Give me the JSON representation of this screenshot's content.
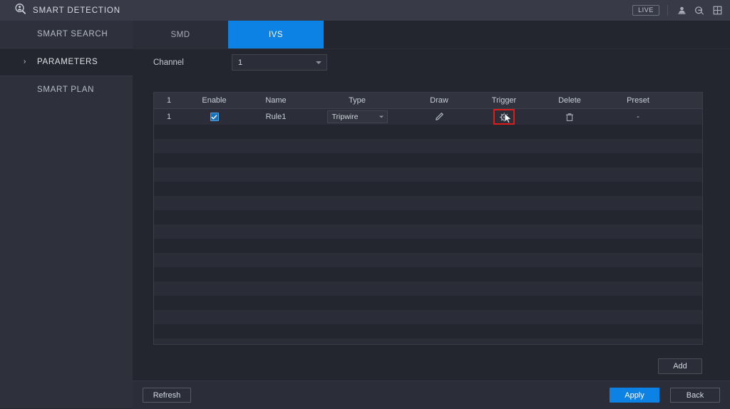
{
  "titlebar": {
    "app_title": "SMART DETECTION",
    "app_icon": "smart-detection-icon",
    "live_label": "LIVE",
    "icons": [
      "user-icon",
      "logout-icon",
      "grid-icon"
    ]
  },
  "sidebar": {
    "items": [
      {
        "label": "SMART SEARCH",
        "active": false
      },
      {
        "label": "PARAMETERS",
        "active": true,
        "chevron": "›"
      },
      {
        "label": "SMART PLAN",
        "active": false
      }
    ]
  },
  "tabs": [
    {
      "label": "SMD",
      "active": false
    },
    {
      "label": "IVS",
      "active": true
    }
  ],
  "channel": {
    "label": "Channel",
    "value": "1",
    "caret_icon": "chevron-down-icon"
  },
  "table": {
    "headers": {
      "index": "1",
      "enable": "Enable",
      "name": "Name",
      "type": "Type",
      "draw": "Draw",
      "trigger": "Trigger",
      "delete": "Delete",
      "preset": "Preset"
    },
    "rows": [
      {
        "index": "1",
        "enabled": true,
        "name": "Rule1",
        "type": "Tripwire",
        "draw_icon": "pencil-icon",
        "trigger_icon": "gear-icon",
        "delete_icon": "trash-icon",
        "preset": "-",
        "trigger_highlighted": true
      }
    ],
    "empty_row_count": 15
  },
  "buttons": {
    "add": "Add",
    "refresh": "Refresh",
    "apply": "Apply",
    "back": "Back"
  },
  "colors": {
    "accent": "#0c82e4",
    "highlight_box": "#e01b1b",
    "titlebar_bg": "#383b47",
    "sidebar_bg": "#2e313c",
    "content_bg": "#24262f"
  }
}
